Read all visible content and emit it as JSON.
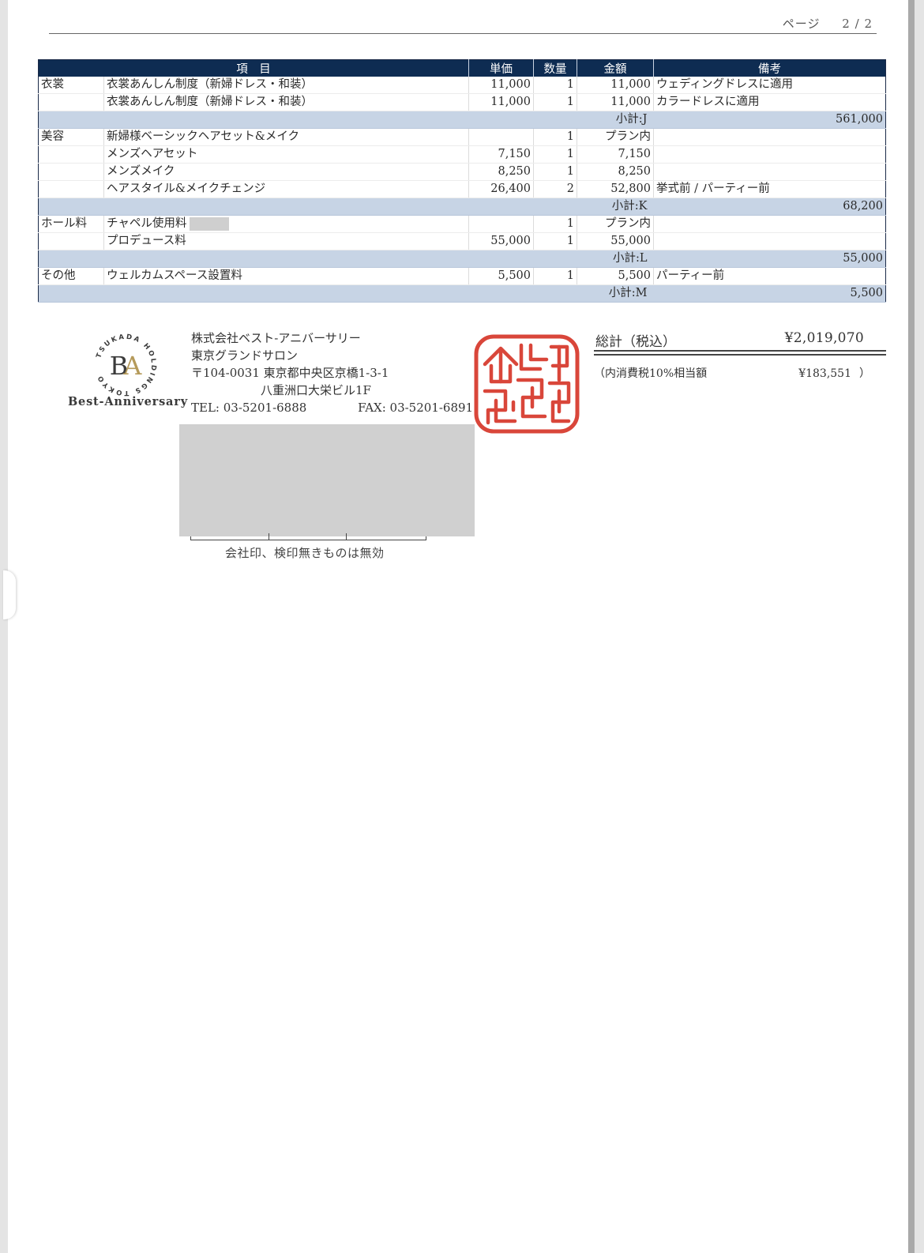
{
  "page": {
    "label": "ページ",
    "current": "2",
    "separator": "/",
    "total": "2"
  },
  "table": {
    "headers": {
      "item": "項　目",
      "unit_price": "単価",
      "quantity": "数量",
      "amount": "金額",
      "note": "備考"
    },
    "rows": [
      {
        "type": "item",
        "category": "衣裳",
        "item": "衣裳あんしん制度（新婦ドレス・和装）",
        "unit_price": "11,000",
        "quantity": "1",
        "amount": "11,000",
        "note": "ウェディングドレスに適用"
      },
      {
        "type": "item",
        "category": "",
        "item": "衣裳あんしん制度（新婦ドレス・和装）",
        "unit_price": "11,000",
        "quantity": "1",
        "amount": "11,000",
        "note": "カラードレスに適用"
      },
      {
        "type": "subtotal",
        "label": "小計:J",
        "value": "561,000"
      },
      {
        "type": "item",
        "category": "美容",
        "item": "新婦様ベーシックヘアセット&メイク",
        "unit_price": "",
        "quantity": "1",
        "amount": "プラン内",
        "note": ""
      },
      {
        "type": "item",
        "category": "",
        "item": "メンズヘアセット",
        "unit_price": "7,150",
        "quantity": "1",
        "amount": "7,150",
        "note": ""
      },
      {
        "type": "item",
        "category": "",
        "item": "メンズメイク",
        "unit_price": "8,250",
        "quantity": "1",
        "amount": "8,250",
        "note": ""
      },
      {
        "type": "item",
        "category": "",
        "item": "ヘアスタイル&メイクチェンジ",
        "unit_price": "26,400",
        "quantity": "2",
        "amount": "52,800",
        "note": "挙式前 / パーティー前"
      },
      {
        "type": "subtotal",
        "label": "小計:K",
        "value": "68,200"
      },
      {
        "type": "item",
        "category": "ホール料",
        "item": "チャペル使用料",
        "redacted": true,
        "unit_price": "",
        "quantity": "1",
        "amount": "プラン内",
        "note": ""
      },
      {
        "type": "item",
        "category": "",
        "item": "プロデュース料",
        "unit_price": "55,000",
        "quantity": "1",
        "amount": "55,000",
        "note": ""
      },
      {
        "type": "subtotal",
        "label": "小計:L",
        "value": "55,000"
      },
      {
        "type": "item",
        "category": "その他",
        "item": "ウェルカムスペース設置料",
        "unit_price": "5,500",
        "quantity": "1",
        "amount": "5,500",
        "note": "パーティー前"
      },
      {
        "type": "subtotal",
        "label": "小計:M",
        "value": "5,500"
      }
    ]
  },
  "logo": {
    "ring_text": "TSUKADA HOLDINGS TOKYO",
    "monogram": "BA",
    "name": "Best-Anniversary",
    "gold": "#b59a5a"
  },
  "company": {
    "name": "株式会社ベスト-アニバーサリー",
    "branch": "東京グランドサロン",
    "address_line1": "〒104-0031 東京都中央区京橋1-3-1",
    "address_line2": "八重洲口大栄ビル1F",
    "tel": "TEL: 03-5201-6888",
    "fax": "FAX: 03-5201-6891"
  },
  "seal_note": "会社印、検印無きものは無効",
  "seal": {
    "color": "#d9463a"
  },
  "totals": {
    "label": "総計（税込）",
    "value": "¥2,019,070",
    "tax_label": "（内消費税10%相当額",
    "tax_value": "¥183,551",
    "tax_close": "）"
  },
  "colors": {
    "header_bg": "#0e2c52",
    "subtotal_bg": "#c7d4e5"
  }
}
